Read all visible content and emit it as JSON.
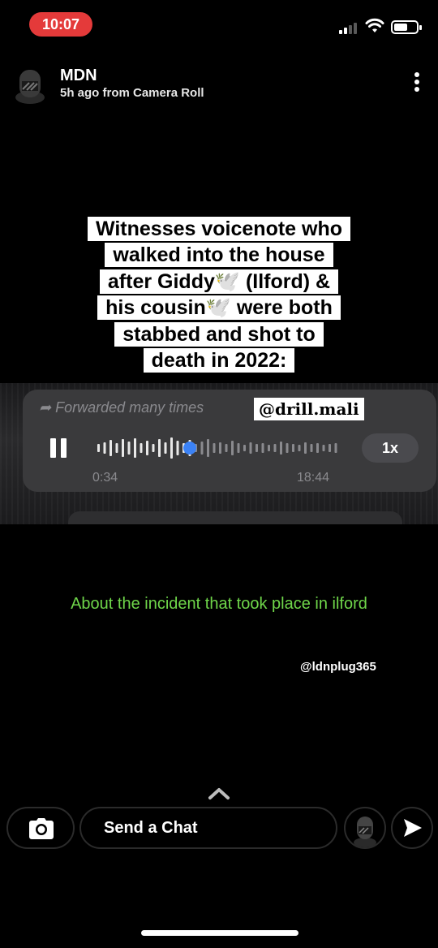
{
  "status_bar": {
    "time": "10:07"
  },
  "story": {
    "username": "MDN",
    "meta": "5h ago from Camera Roll"
  },
  "caption": {
    "lines": [
      "Witnesses voicenote who",
      "walked into the house",
      "after Giddy🕊️ (Ilford) &",
      "his cousin🕊️ were both",
      "stabbed and shot to",
      "death in 2022:"
    ]
  },
  "voice_note": {
    "forwarded": "Forwarded many times",
    "watermark": "@drill.mali",
    "speed": "1x",
    "elapsed": "0:34",
    "duration": "18:44",
    "progress_fraction": 0.38
  },
  "subtitle": "About the incident that took place in ilford",
  "watermark_bottom": "@ldnplug365",
  "chat_bar": {
    "placeholder": "Send a Chat"
  },
  "colors": {
    "status_pill": "#e43a3a",
    "subtitle": "#6fd64a",
    "progress_dot": "#3b82f6"
  }
}
